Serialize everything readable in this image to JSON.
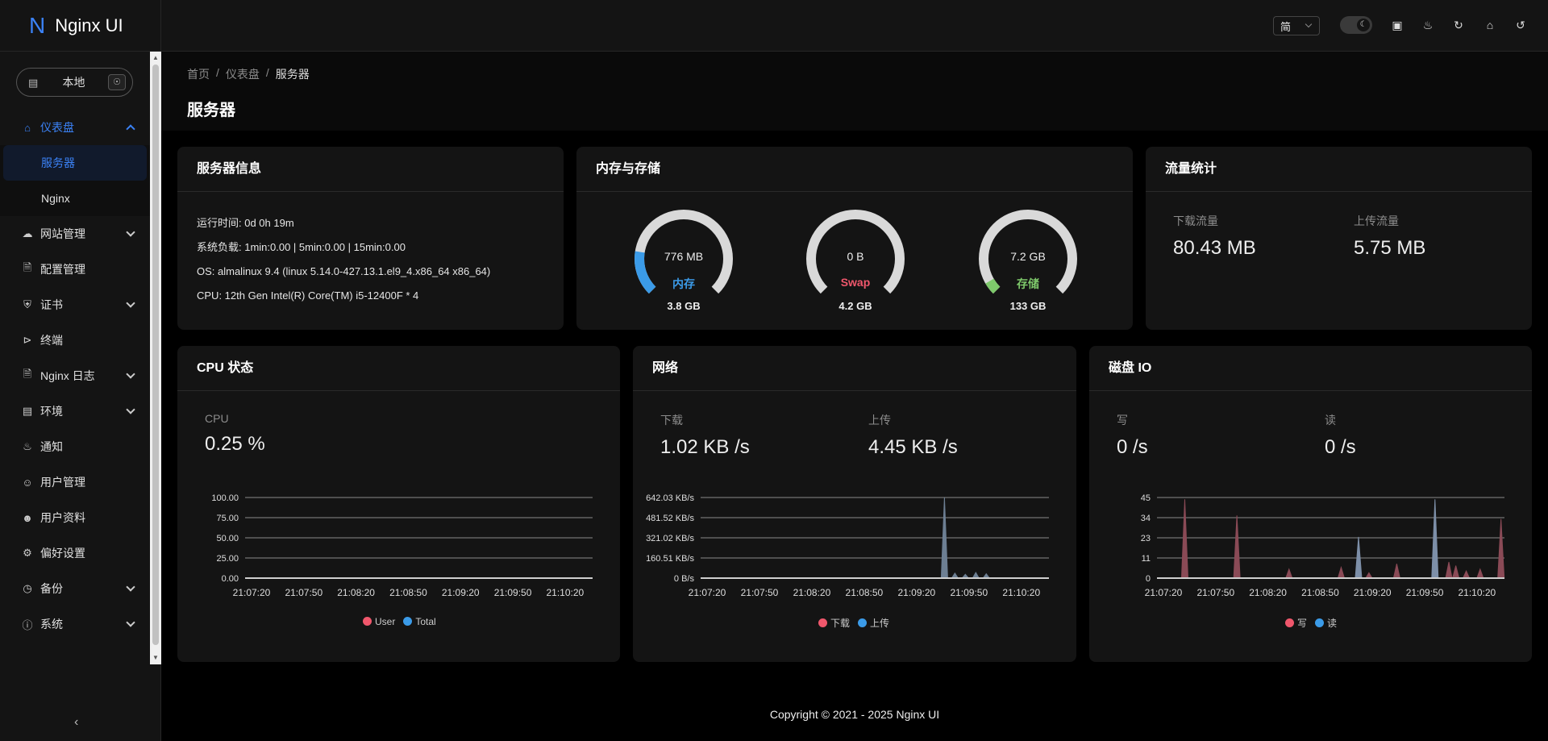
{
  "brand": {
    "logo": "N",
    "name": "Nginx UI"
  },
  "env": {
    "label": "本地"
  },
  "menu": {
    "dashboard": "仪表盘",
    "server": "服务器",
    "nginx": "Nginx",
    "sites": "网站管理",
    "config": "配置管理",
    "cert": "证书",
    "terminal": "终端",
    "nginx_log": "Nginx 日志",
    "environment": "环境",
    "notification": "通知",
    "users": "用户管理",
    "profile": "用户资料",
    "preference": "偏好设置",
    "backup": "备份",
    "system": "系统"
  },
  "header": {
    "lang": "简"
  },
  "breadcrumb": [
    "首页",
    "仪表盘",
    "服务器"
  ],
  "page_title": "服务器",
  "server_info": {
    "title": "服务器信息",
    "lines": [
      "运行时间: 0d 0h 19m",
      "系统负载: 1min:0.00 | 5min:0.00 | 15min:0.00",
      "OS: almalinux 9.4 (linux 5.14.0-427.13.1.el9_4.x86_64 x86_64)",
      "CPU: 12th Gen Intel(R) Core(TM) i5-12400F * 4"
    ]
  },
  "memory": {
    "title": "内存与存储",
    "gauges": [
      {
        "value": "776 MB",
        "label": "内存",
        "total": "3.8 GB",
        "percent": 0.2,
        "color": "#3b9be8"
      },
      {
        "value": "0 B",
        "label": "Swap",
        "total": "4.2 GB",
        "percent": 0.0,
        "color": "#f0576c"
      },
      {
        "value": "7.2 GB",
        "label": "存储",
        "total": "133 GB",
        "percent": 0.055,
        "color": "#7ec96b"
      }
    ]
  },
  "traffic": {
    "title": "流量统计",
    "download_label": "下载流量",
    "download": "80.43 MB",
    "upload_label": "上传流量",
    "upload": "5.75 MB"
  },
  "cpu": {
    "title": "CPU 状态",
    "label": "CPU",
    "value": "0.25 %",
    "legend": [
      "User",
      "Total"
    ]
  },
  "network": {
    "title": "网络",
    "down_label": "下载",
    "down": "1.02 KB /s",
    "up_label": "上传",
    "up": "4.45 KB /s",
    "legend": [
      "下载",
      "上传"
    ]
  },
  "disk": {
    "title": "磁盘 IO",
    "write_label": "写",
    "write": "0 /s",
    "read_label": "读",
    "read": "0 /s",
    "legend": [
      "写",
      "读"
    ]
  },
  "chart_data": [
    {
      "type": "area",
      "title": "CPU",
      "x": [
        "21:07:20",
        "21:07:50",
        "21:08:20",
        "21:08:50",
        "21:09:20",
        "21:09:50",
        "21:10:20"
      ],
      "yticks": [
        "100.00",
        "75.00",
        "50.00",
        "25.00",
        "0.00"
      ],
      "ylim": [
        0,
        100
      ],
      "series": [
        {
          "name": "User",
          "color": "#f0576c",
          "values": [
            0,
            0,
            0,
            0,
            0,
            0,
            0
          ]
        },
        {
          "name": "Total",
          "color": "#3b9be8",
          "values": [
            0.3,
            0.2,
            0.3,
            0.2,
            0.3,
            0.2,
            0.25
          ]
        }
      ]
    },
    {
      "type": "area",
      "title": "网络",
      "x": [
        "21:07:20",
        "21:07:50",
        "21:08:20",
        "21:08:50",
        "21:09:20",
        "21:09:50",
        "21:10:20"
      ],
      "yticks": [
        "642.03 KB/s",
        "481.52 KB/s",
        "321.02 KB/s",
        "160.51 KB/s",
        "0 B/s"
      ],
      "ylim": [
        0,
        642.03
      ],
      "spikes": [
        {
          "t": 0.7,
          "value": 642.03
        },
        {
          "t": 0.73,
          "value": 40
        },
        {
          "t": 0.76,
          "value": 30
        },
        {
          "t": 0.79,
          "value": 45
        },
        {
          "t": 0.82,
          "value": 35
        }
      ],
      "series": [
        {
          "name": "下载",
          "color": "#f0576c"
        },
        {
          "name": "上传",
          "color": "#3b9be8"
        }
      ]
    },
    {
      "type": "area",
      "title": "磁盘 IO",
      "x": [
        "21:07:20",
        "21:07:50",
        "21:08:20",
        "21:08:50",
        "21:09:20",
        "21:09:50",
        "21:10:20"
      ],
      "yticks": [
        "45",
        "34",
        "23",
        "11",
        "0"
      ],
      "ylim": [
        0,
        45
      ],
      "spikes": [
        {
          "t": 0.08,
          "value": 44,
          "s": 0
        },
        {
          "t": 0.23,
          "value": 35,
          "s": 0
        },
        {
          "t": 0.38,
          "value": 5,
          "s": 0
        },
        {
          "t": 0.53,
          "value": 6,
          "s": 0
        },
        {
          "t": 0.58,
          "value": 23,
          "s": 1
        },
        {
          "t": 0.61,
          "value": 3,
          "s": 0
        },
        {
          "t": 0.69,
          "value": 8,
          "s": 0
        },
        {
          "t": 0.8,
          "value": 44,
          "s": 1
        },
        {
          "t": 0.84,
          "value": 9,
          "s": 0
        },
        {
          "t": 0.86,
          "value": 7,
          "s": 0
        },
        {
          "t": 0.89,
          "value": 4,
          "s": 0
        },
        {
          "t": 0.93,
          "value": 5,
          "s": 0
        },
        {
          "t": 0.99,
          "value": 33,
          "s": 0
        }
      ],
      "series": [
        {
          "name": "写",
          "color": "#f0576c"
        },
        {
          "name": "读",
          "color": "#3b9be8"
        }
      ]
    }
  ],
  "footer": "Copyright © 2021 - 2025 Nginx UI"
}
